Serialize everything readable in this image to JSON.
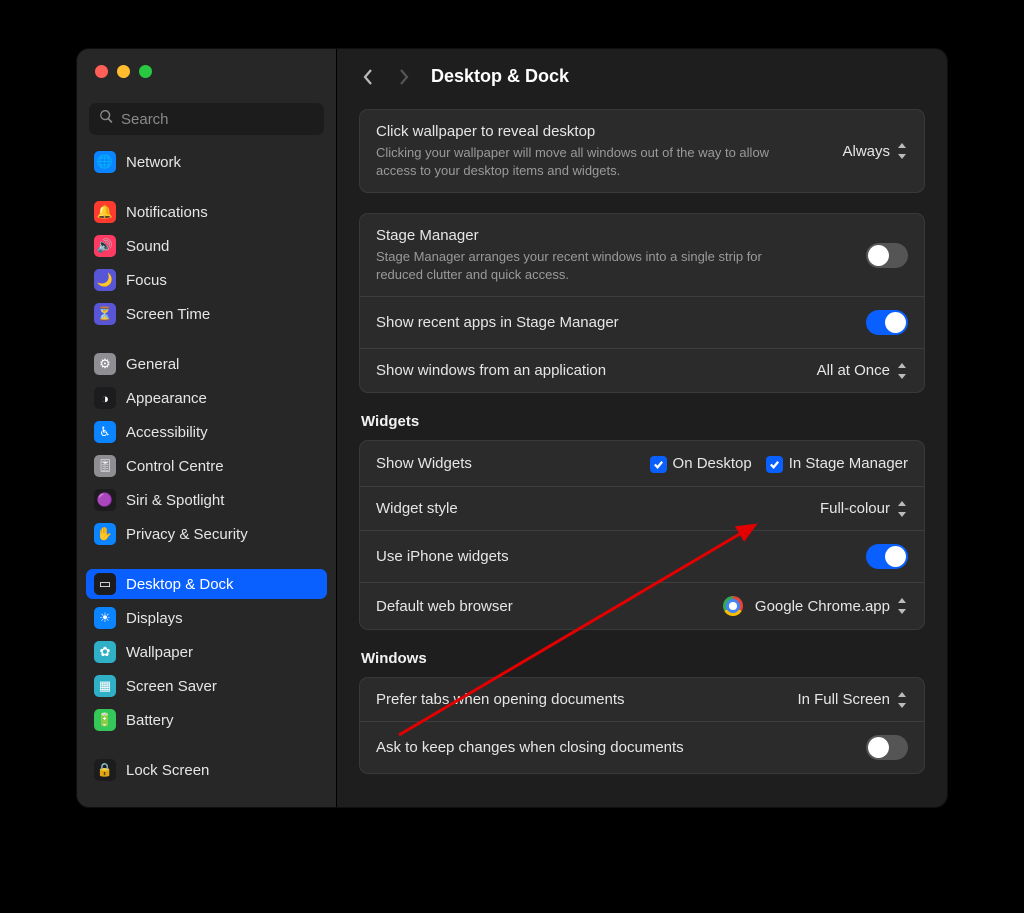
{
  "sidebar": {
    "search_placeholder": "Search",
    "items": [
      {
        "id": "network",
        "label": "Network",
        "icon_bg": "#0a84ff",
        "glyph": "🌐"
      },
      {
        "id": "notifications",
        "label": "Notifications",
        "icon_bg": "#ff3b30",
        "glyph": "🔔"
      },
      {
        "id": "sound",
        "label": "Sound",
        "icon_bg": "#ff3b63",
        "glyph": "🔊"
      },
      {
        "id": "focus",
        "label": "Focus",
        "icon_bg": "#5856d6",
        "glyph": "🌙"
      },
      {
        "id": "screentime",
        "label": "Screen Time",
        "icon_bg": "#5856d6",
        "glyph": "⏳"
      },
      {
        "id": "general",
        "label": "General",
        "icon_bg": "#8e8e93",
        "glyph": "⚙︎"
      },
      {
        "id": "appearance",
        "label": "Appearance",
        "icon_bg": "#1c1c1e",
        "glyph": "◑"
      },
      {
        "id": "accessibility",
        "label": "Accessibility",
        "icon_bg": "#0a84ff",
        "glyph": "♿︎"
      },
      {
        "id": "controlcentre",
        "label": "Control Centre",
        "icon_bg": "#8e8e93",
        "glyph": "🎚"
      },
      {
        "id": "siri",
        "label": "Siri & Spotlight",
        "icon_bg": "#1c1c1e",
        "glyph": "🟣"
      },
      {
        "id": "privacy",
        "label": "Privacy & Security",
        "icon_bg": "#0a84ff",
        "glyph": "✋"
      },
      {
        "id": "desktopdock",
        "label": "Desktop & Dock",
        "icon_bg": "#1c1c1e",
        "glyph": "▭"
      },
      {
        "id": "displays",
        "label": "Displays",
        "icon_bg": "#0a84ff",
        "glyph": "☀︎"
      },
      {
        "id": "wallpaper",
        "label": "Wallpaper",
        "icon_bg": "#30b0c7",
        "glyph": "✿"
      },
      {
        "id": "screensaver",
        "label": "Screen Saver",
        "icon_bg": "#30b0c7",
        "glyph": "▦"
      },
      {
        "id": "battery",
        "label": "Battery",
        "icon_bg": "#34c759",
        "glyph": "🔋"
      },
      {
        "id": "lockscreen",
        "label": "Lock Screen",
        "icon_bg": "#1c1c1e",
        "glyph": "🔒"
      }
    ],
    "group_breaks": [
      1,
      5,
      11,
      16
    ],
    "selected": "desktopdock"
  },
  "header": {
    "title": "Desktop & Dock"
  },
  "panel_wallpaper": {
    "title": "Click wallpaper to reveal desktop",
    "desc": "Clicking your wallpaper will move all windows out of the way to allow access to your desktop items and widgets.",
    "value": "Always"
  },
  "panel_stage": {
    "title": "Stage Manager",
    "desc": "Stage Manager arranges your recent windows into a single strip for reduced clutter and quick access.",
    "toggle": false,
    "recent_label": "Show recent apps in Stage Manager",
    "recent_toggle": true,
    "showwin_label": "Show windows from an application",
    "showwin_value": "All at Once"
  },
  "section_widgets": {
    "heading": "Widgets",
    "show_label": "Show Widgets",
    "cb1": "On Desktop",
    "cb2": "In Stage Manager",
    "style_label": "Widget style",
    "style_value": "Full-colour",
    "iphone_label": "Use iPhone widgets",
    "iphone_toggle": true,
    "browser_label": "Default web browser",
    "browser_value": "Google Chrome.app"
  },
  "section_windows": {
    "heading": "Windows",
    "tabs_label": "Prefer tabs when opening documents",
    "tabs_value": "In Full Screen",
    "ask_label": "Ask to keep changes when closing documents",
    "ask_toggle": false
  }
}
